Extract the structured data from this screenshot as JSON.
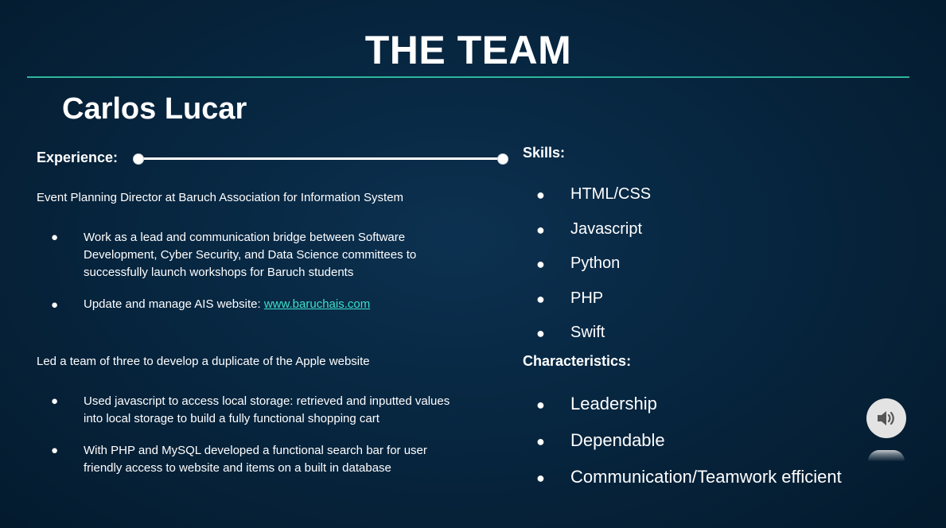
{
  "slide": {
    "title": "THE TEAM",
    "member_name": "Carlos Lucar"
  },
  "experience": {
    "heading": "Experience:",
    "roles": [
      {
        "title": "Event Planning Director at Baruch Association for Information System",
        "bullets": [
          "Work as a lead and communication bridge between Software Development, Cyber Security, and Data Science committees to successfully launch workshops for Baruch students",
          "Update and manage AIS website: "
        ],
        "link_text": "www.baruchais.com"
      },
      {
        "title": "Led a team of three to develop a duplicate of the Apple website",
        "bullets": [
          "Used javascript to access local storage: retrieved and inputted values into local storage to build a fully functional shopping cart",
          "With PHP and MySQL developed a functional search bar for user friendly access to website and items on a built in database"
        ]
      }
    ]
  },
  "skills": {
    "heading": "Skills:",
    "items": [
      "HTML/CSS",
      "Javascript",
      "Python",
      "PHP",
      "Swift"
    ]
  },
  "characteristics": {
    "heading": "Characteristics:",
    "items": [
      "Leadership",
      "Dependable",
      "Communication/Teamwork efficient"
    ]
  },
  "bullet_glyph": "●",
  "controls": {
    "audio_icon": "speaker-icon"
  },
  "colors": {
    "accent": "#2fb59c",
    "link": "#3de0c9",
    "background": "#072640"
  }
}
